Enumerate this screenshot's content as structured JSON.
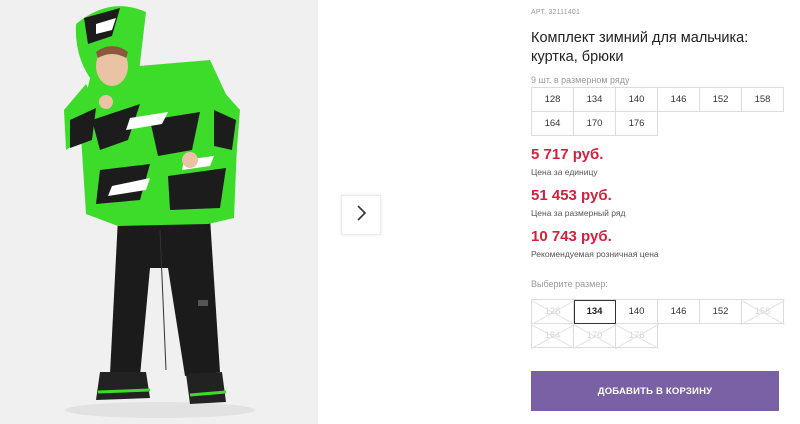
{
  "product": {
    "article": "АРТ. 32111401",
    "title": "Комплект зимний для мальчика: куртка, брюки",
    "row_count_label": "9 шт. в размерном ряду",
    "row_sizes": [
      "128",
      "134",
      "140",
      "146",
      "152",
      "158",
      "164",
      "170",
      "176"
    ]
  },
  "prices": [
    {
      "value": "5 717 руб.",
      "note": "Цена за единицу"
    },
    {
      "value": "51 453 руб.",
      "note": "Цена за размерный ряд"
    },
    {
      "value": "10 743 руб.",
      "note": "Рекомендуемая розничная цена"
    }
  ],
  "size_picker": {
    "label": "Выберите размер:",
    "options": [
      {
        "label": "128",
        "state": "disabled"
      },
      {
        "label": "134",
        "state": "selected"
      },
      {
        "label": "140",
        "state": "available"
      },
      {
        "label": "146",
        "state": "available"
      },
      {
        "label": "152",
        "state": "available"
      },
      {
        "label": "158",
        "state": "disabled"
      },
      {
        "label": "164",
        "state": "disabled"
      },
      {
        "label": "170",
        "state": "disabled"
      },
      {
        "label": "176",
        "state": "disabled"
      }
    ]
  },
  "cart_button": {
    "label": "ДОБАВИТЬ В КОРЗИНУ"
  },
  "gallery": {
    "next_icon": "chevron-right-icon"
  },
  "colors": {
    "price_red": "#d4213c",
    "button_purple": "#7a61a5",
    "jacket_green": "#3ddc2a",
    "jacket_black": "#1c1c1c"
  }
}
